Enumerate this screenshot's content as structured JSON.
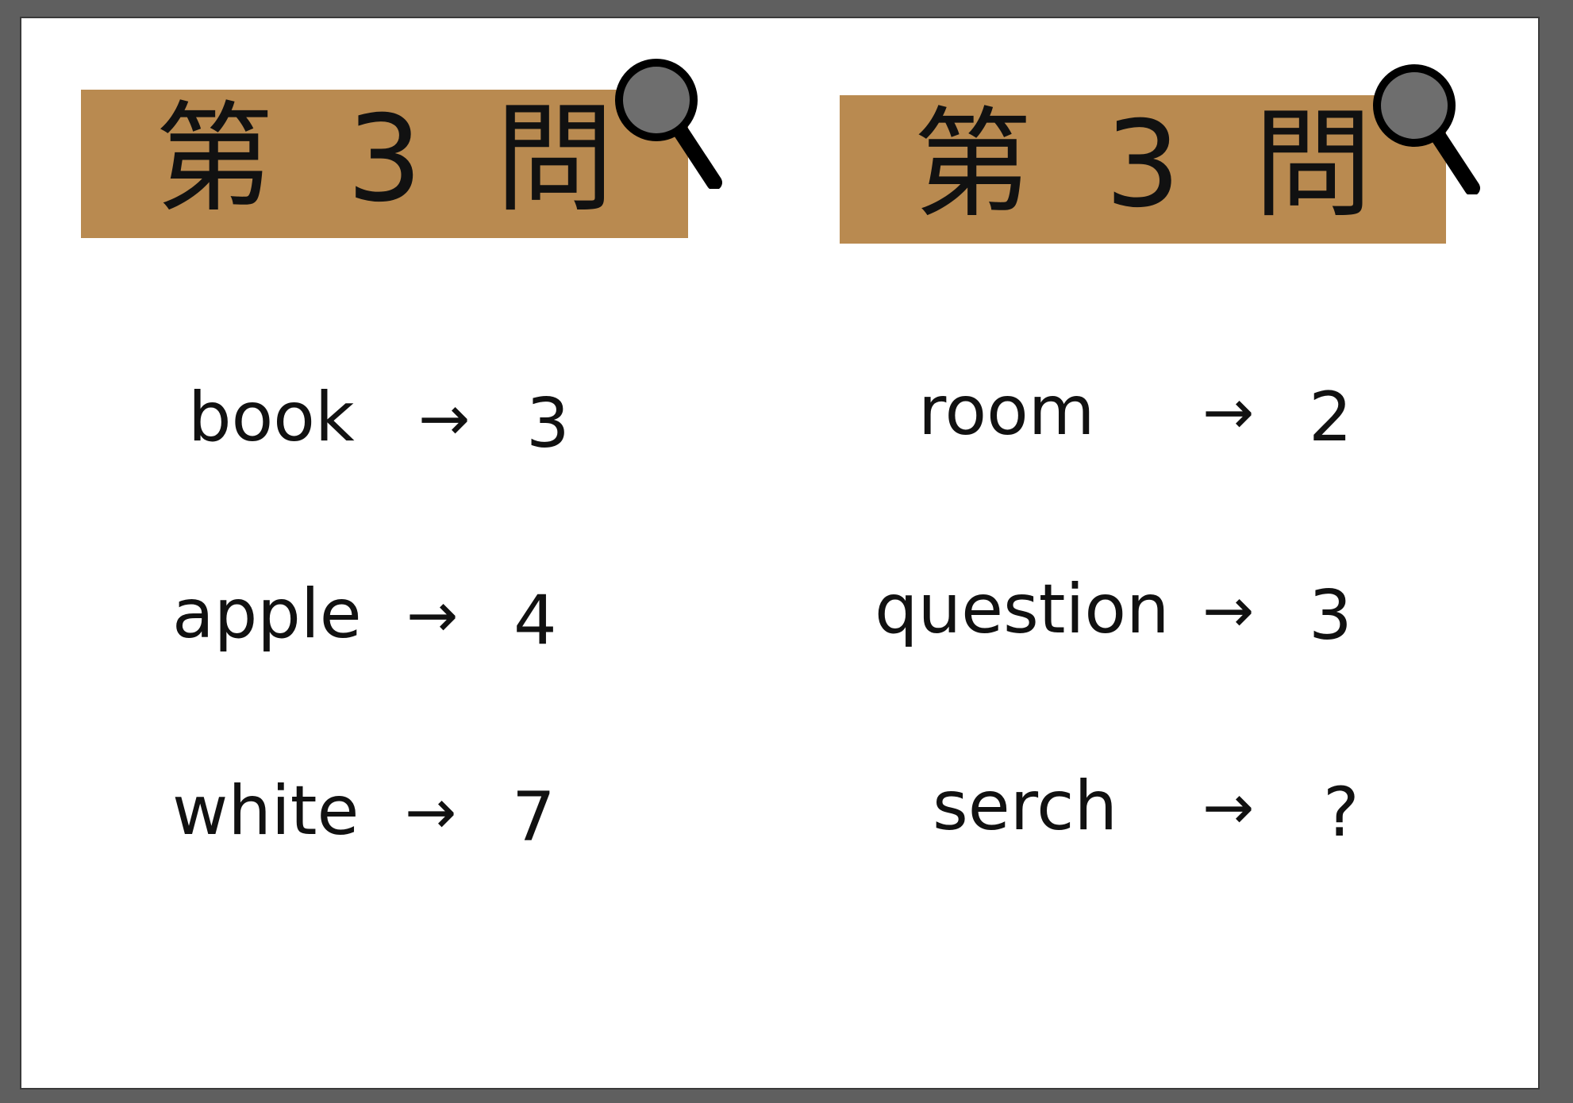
{
  "colors": {
    "frame": "#5f5f5f",
    "slide": "#ffffff",
    "title_bar": "#b98a50",
    "text": "#111111",
    "magnifier_lens": "#6e6e6e",
    "magnifier_outline": "#000000"
  },
  "left_panel": {
    "title": "第 3 問",
    "icon": "magnifier-icon",
    "rows": [
      {
        "word": "book",
        "arrow": "→",
        "value": "3"
      },
      {
        "word": "apple",
        "arrow": "→",
        "value": "4"
      },
      {
        "word": "white",
        "arrow": "→",
        "value": "7"
      }
    ]
  },
  "right_panel": {
    "title": "第 3 問",
    "icon": "magnifier-icon",
    "rows": [
      {
        "word": "room",
        "arrow": "→",
        "value": "2"
      },
      {
        "word": "question",
        "arrow": "→",
        "value": "3"
      },
      {
        "word": "serch",
        "arrow": "→",
        "value": "?"
      }
    ]
  }
}
